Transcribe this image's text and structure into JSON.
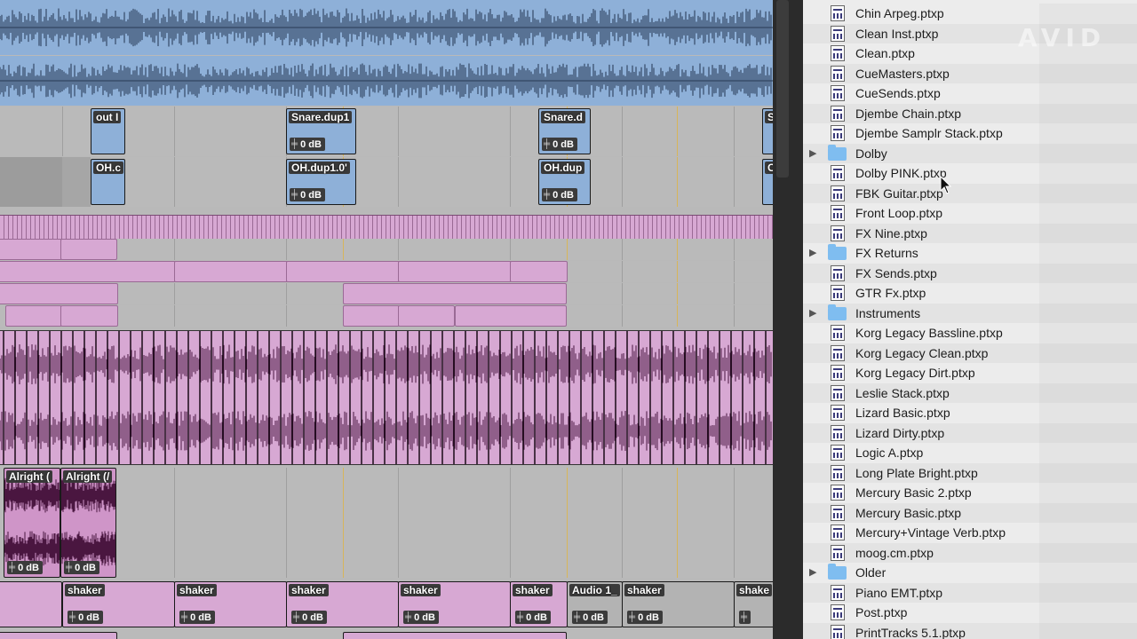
{
  "edit_window": {
    "clips": {
      "kick_out": "out I",
      "snare_dup_1": "Snare.dup1",
      "snare_d": "Snare.d",
      "s_edge": "S",
      "oh_c": "OH.c",
      "oh_dup": "OH.dup1.0'",
      "oh_dup2": "OH.dup",
      "c_edge": "C",
      "alright_1": "Alright (",
      "alright_2": "Alright (/",
      "shaker_1": "shaker",
      "shaker_2": "shaker",
      "shaker_3": "shaker",
      "shaker_4": "shaker",
      "shaker_5": "shaker",
      "audio_1": "Audio 1_",
      "shaker_6": "shaker",
      "shaker_7": "shake"
    },
    "gain_label": "0 dB"
  },
  "browser": {
    "items": [
      {
        "type": "file",
        "name": "Chin Arpeg.ptxp"
      },
      {
        "type": "file",
        "name": "Clean Inst.ptxp"
      },
      {
        "type": "file",
        "name": "Clean.ptxp"
      },
      {
        "type": "file",
        "name": "CueMasters.ptxp"
      },
      {
        "type": "file",
        "name": "CueSends.ptxp"
      },
      {
        "type": "file",
        "name": "Djembe Chain.ptxp"
      },
      {
        "type": "file",
        "name": "Djembe Samplr Stack.ptxp"
      },
      {
        "type": "folder",
        "name": "Dolby"
      },
      {
        "type": "file",
        "name": "Dolby PINK.ptxp"
      },
      {
        "type": "file",
        "name": "FBK Guitar.ptxp"
      },
      {
        "type": "file",
        "name": "Front Loop.ptxp"
      },
      {
        "type": "file",
        "name": "FX Nine.ptxp"
      },
      {
        "type": "folder",
        "name": "FX Returns"
      },
      {
        "type": "file",
        "name": "FX Sends.ptxp"
      },
      {
        "type": "file",
        "name": "GTR Fx.ptxp"
      },
      {
        "type": "folder",
        "name": "Instruments"
      },
      {
        "type": "file",
        "name": "Korg Legacy Bassline.ptxp"
      },
      {
        "type": "file",
        "name": "Korg Legacy Clean.ptxp"
      },
      {
        "type": "file",
        "name": "Korg Legacy Dirt.ptxp"
      },
      {
        "type": "file",
        "name": "Leslie Stack.ptxp"
      },
      {
        "type": "file",
        "name": "Lizard Basic.ptxp"
      },
      {
        "type": "file",
        "name": "Lizard Dirty.ptxp"
      },
      {
        "type": "file",
        "name": "Logic A.ptxp"
      },
      {
        "type": "file",
        "name": "Long Plate Bright.ptxp"
      },
      {
        "type": "file",
        "name": "Mercury Basic 2.ptxp"
      },
      {
        "type": "file",
        "name": "Mercury Basic.ptxp"
      },
      {
        "type": "file",
        "name": "Mercury+Vintage Verb.ptxp"
      },
      {
        "type": "file",
        "name": "moog.cm.ptxp"
      },
      {
        "type": "folder",
        "name": "Older"
      },
      {
        "type": "file",
        "name": "Piano EMT.ptxp"
      },
      {
        "type": "file",
        "name": "Post.ptxp"
      },
      {
        "type": "file",
        "name": "PrintTracks 5.1.ptxp"
      }
    ]
  },
  "watermark": "AVID",
  "colors": {
    "audio_blue": "#8eb0d8",
    "audio_pink": "#d7a8d3",
    "waveform_dark": "#4a1640",
    "folder_blue": "#7fbdf0"
  }
}
